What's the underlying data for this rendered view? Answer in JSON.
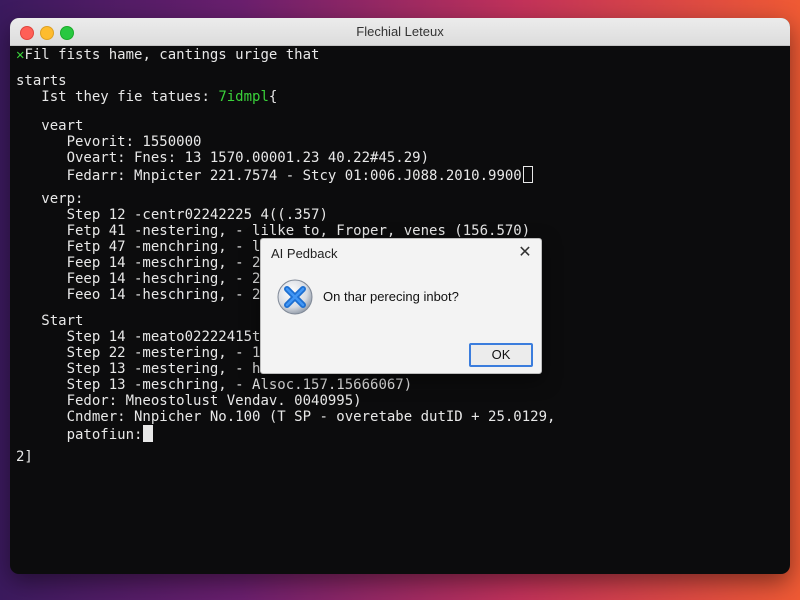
{
  "window": {
    "title": "Flechial Leteux"
  },
  "terminal": {
    "header": {
      "mark": "✕",
      "text": "Fil fists hame, cantings urige that"
    },
    "lines": [
      {
        "indent": "",
        "text": "starts"
      },
      {
        "indent": "   ",
        "text": "Ist they fie tatues: ",
        "green": "7idmpl",
        "tail": "{"
      },
      {
        "indent": "   ",
        "text": "veart"
      },
      {
        "indent": "      ",
        "text": "Pevorit: 1550000"
      },
      {
        "indent": "      ",
        "text": "Oveart: Fnes: 13 1570.00001.23 40.22#45.29)"
      },
      {
        "indent": "      ",
        "text": "Fedarr: Mnpicter 221.7574 - Stcy 01:006.J088.2010.9900"
      },
      {
        "indent": "   ",
        "text": "verp:"
      },
      {
        "indent": "      ",
        "text": "Step 12 -centr02242225 4((.357)"
      },
      {
        "indent": "      ",
        "text": "Fetp 41 -nestering, - lilke to, Froper, venes (156.570)"
      },
      {
        "indent": "      ",
        "text": "Fetp 47 -menchring, - lls"
      },
      {
        "indent": "      ",
        "text": "Feep 14 -meschring, - 22"
      },
      {
        "indent": "      ",
        "text": "Feep 14 -heschring, - 21s"
      },
      {
        "indent": "      ",
        "text": "Feeo 14 -heschring, - 229"
      },
      {
        "indent": "   ",
        "text": "Start"
      },
      {
        "indent": "      ",
        "text": "Step 14 -meato02222415ts"
      },
      {
        "indent": "      ",
        "text": "Step 22 -mestering, - 115"
      },
      {
        "indent": "      ",
        "text": "Step 13 -mestering, - hew"
      },
      {
        "indent": "      ",
        "text": "Step 13 -meschring, - Alsoc.157.15666067)"
      },
      {
        "indent": "      ",
        "text": "Fedor: Mneostolust Vendav. 0040995)"
      },
      {
        "indent": "      ",
        "text": "Cndmer: Nnpicher No.100 (T SP - overetabe dutID + 25.0129,"
      },
      {
        "indent": "      ",
        "text": "patofiun:"
      },
      {
        "indent": "",
        "text": "2]"
      }
    ]
  },
  "dialog": {
    "title": "AI Pedback",
    "close_glyph": "✕",
    "icon": "error-x-icon",
    "message": "On thar perecing inbot?",
    "ok_label": "OK"
  },
  "colors": {
    "terminal_bg": "#0c0c0d",
    "terminal_text": "#e8e8e8",
    "accent_green": "#3ad13a",
    "ok_border": "#3b7ddd",
    "error_icon_blue": "#1d6fd1"
  }
}
